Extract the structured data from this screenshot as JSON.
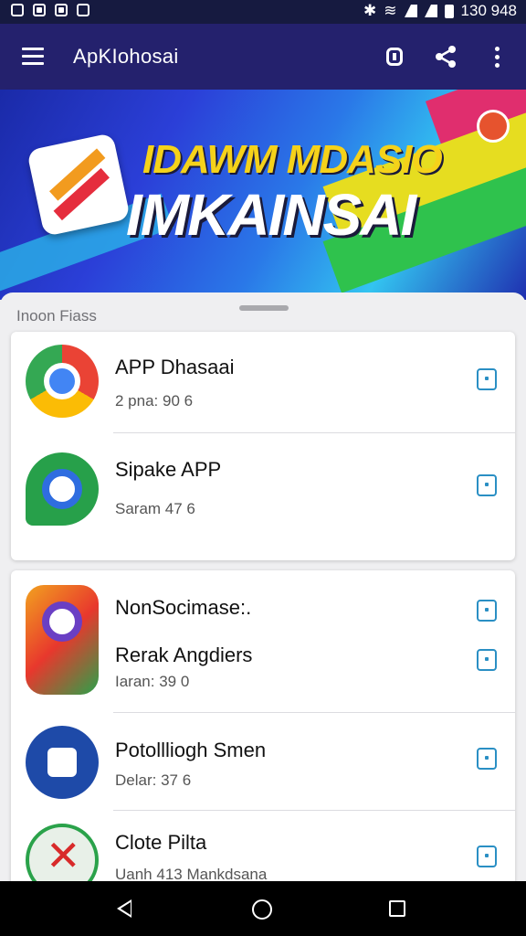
{
  "status_bar": {
    "time": "130 948"
  },
  "app_bar": {
    "title": "ApKIohosai"
  },
  "banner": {
    "line1": "IDAWM MDASIO",
    "line2": "IMKAINSAI"
  },
  "section": {
    "label": "Inoon Fiass"
  },
  "cards": [
    {
      "items": [
        {
          "name": "APP Dhasaai",
          "sub": "2 pna: 90 6",
          "icon": "chrome-icon"
        },
        {
          "name": "Sipake APP",
          "sub": "Saram 47 6",
          "icon": "green-app-icon"
        }
      ]
    },
    {
      "items": [
        {
          "name": "NonSocimase:.",
          "sub": "",
          "icon": "multicolor-app-icon"
        },
        {
          "name": "Rerak Angdiers",
          "sub": "Iaran: 39 0",
          "icon": ""
        },
        {
          "name": "Potollliogh Smen",
          "sub": "Delar: 37 6",
          "icon": "blue-app-icon"
        },
        {
          "name": "Clote Pilta",
          "sub": "Uanh 413 Mankdsana",
          "icon": "red-x-app-icon"
        }
      ]
    }
  ]
}
